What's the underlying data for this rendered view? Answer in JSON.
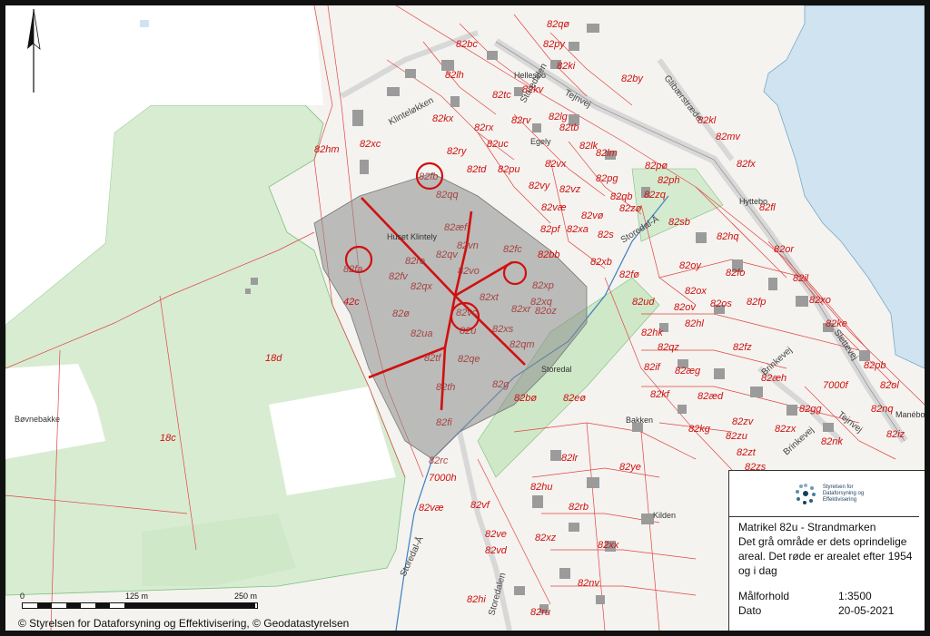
{
  "map": {
    "parcel_labels_primary": [
      {
        "id": "82qø"
      },
      {
        "id": "82py"
      },
      {
        "id": "82bc"
      },
      {
        "id": "82ki"
      },
      {
        "id": "82lh"
      },
      {
        "id": "82by"
      },
      {
        "id": "82tc"
      },
      {
        "id": "82kv"
      },
      {
        "id": "82kx"
      },
      {
        "id": "82lg"
      },
      {
        "id": "82rx"
      },
      {
        "id": "82rv"
      },
      {
        "id": "82tb"
      },
      {
        "id": "82kl"
      },
      {
        "id": "82mv"
      },
      {
        "id": "82hm"
      },
      {
        "id": "82xc"
      },
      {
        "id": "82uc"
      },
      {
        "id": "82ry"
      },
      {
        "id": "82lk"
      },
      {
        "id": "82lm"
      },
      {
        "id": "82td"
      },
      {
        "id": "82pu"
      },
      {
        "id": "82vx"
      },
      {
        "id": "82pø"
      },
      {
        "id": "82fx"
      },
      {
        "id": "82pg"
      },
      {
        "id": "82ph"
      },
      {
        "id": "82vy"
      },
      {
        "id": "82vz"
      },
      {
        "id": "82qb"
      },
      {
        "id": "82zq"
      },
      {
        "id": "82fl"
      },
      {
        "id": "82væ"
      },
      {
        "id": "82vø"
      },
      {
        "id": "82zø"
      },
      {
        "id": "82sb"
      },
      {
        "id": "82pf"
      },
      {
        "id": "82xa"
      },
      {
        "id": "82s"
      },
      {
        "id": "82hq"
      },
      {
        "id": "82or"
      },
      {
        "id": "82bb"
      },
      {
        "id": "82xb"
      },
      {
        "id": "82oy"
      },
      {
        "id": "82fø"
      },
      {
        "id": "82fo"
      },
      {
        "id": "82il"
      },
      {
        "id": "82ox"
      },
      {
        "id": "82xo"
      },
      {
        "id": "82ud"
      },
      {
        "id": "82ov"
      },
      {
        "id": "82os"
      },
      {
        "id": "82fp"
      },
      {
        "id": "82hl"
      },
      {
        "id": "82ke"
      },
      {
        "id": "82hk"
      },
      {
        "id": "82qz"
      },
      {
        "id": "82fz"
      },
      {
        "id": "82pb"
      },
      {
        "id": "82if"
      },
      {
        "id": "82æg"
      },
      {
        "id": "82æh"
      },
      {
        "id": "82ol"
      },
      {
        "id": "82kf"
      },
      {
        "id": "82æd"
      },
      {
        "id": "82gg"
      },
      {
        "id": "82nq"
      },
      {
        "id": "82kg"
      },
      {
        "id": "82zv"
      },
      {
        "id": "82zx"
      },
      {
        "id": "82zu"
      },
      {
        "id": "82nk"
      },
      {
        "id": "82iz"
      },
      {
        "id": "82zt"
      },
      {
        "id": "82zs"
      },
      {
        "id": "82bø"
      },
      {
        "id": "82eø"
      },
      {
        "id": "82lr"
      },
      {
        "id": "82ye"
      },
      {
        "id": "82hu"
      },
      {
        "id": "82vf"
      },
      {
        "id": "82rb"
      },
      {
        "id": "82ve"
      },
      {
        "id": "82xz"
      },
      {
        "id": "82vd"
      },
      {
        "id": "82xx"
      },
      {
        "id": "82nv"
      },
      {
        "id": "82ru"
      },
      {
        "id": "82hi"
      },
      {
        "id": "82væ"
      },
      {
        "id": "82rc"
      },
      {
        "id": "82fi"
      },
      {
        "id": "82th"
      },
      {
        "id": "82g"
      },
      {
        "id": "82tf"
      },
      {
        "id": "82qe"
      },
      {
        "id": "82qm"
      },
      {
        "id": "82oz"
      },
      {
        "id": "82xs"
      },
      {
        "id": "82xr"
      },
      {
        "id": "82xq"
      },
      {
        "id": "82xp"
      },
      {
        "id": "82xt"
      },
      {
        "id": "82ua"
      },
      {
        "id": "82u"
      },
      {
        "id": "82vc"
      },
      {
        "id": "82ø"
      },
      {
        "id": "82qx"
      },
      {
        "id": "82fv"
      },
      {
        "id": "82fa"
      },
      {
        "id": "82ro"
      },
      {
        "id": "82vn"
      },
      {
        "id": "82fc"
      },
      {
        "id": "82vo"
      },
      {
        "id": "82æf"
      },
      {
        "id": "82qq"
      },
      {
        "id": "82fb"
      },
      {
        "id": "82qv"
      },
      {
        "id": "42c"
      },
      {
        "id": "18d"
      },
      {
        "id": "18c"
      },
      {
        "id": "7000f"
      },
      {
        "id": "7000h"
      }
    ],
    "place_names": {
      "bovnebakke": "Bøvnebakke",
      "kilden": "Kilden",
      "hyttebo": "Hyttebo",
      "hus_klintely": "Huset Klintely",
      "storedal": "Storedal",
      "egely": "Egely",
      "hellesbo": "Hellesbo",
      "bakken": "Bakken",
      "maneborg": "Manéborg"
    },
    "streets": {
      "klintelokken": "Klinteløkken",
      "storedalen_n": "Storedalen",
      "tejnvej_n": "Tejnvej",
      "glibaerstraede": "Glibærstræde",
      "storedal_a_mid": "Storedal-Å",
      "storedal_a_s": "Storedal-Å",
      "storedalen_s": "Storedalen",
      "slettevej": "Slettevej",
      "brinkevej": "Brinkevej",
      "tejnvej_s": "Tejnvej",
      "brinkevej_s": "Brinkevej"
    }
  },
  "scale_bar": {
    "t0": "0",
    "t125": "125 m",
    "t250": "250 m"
  },
  "legend": {
    "logo_text_1": "Styrelsen for",
    "logo_text_2": "Dataforsyning og",
    "logo_text_3": "Effektivisering",
    "title": "Matrikel 82u - Strandmarken",
    "description": "Det grå område er dets oprindelige areal. Det røde er arealet efter 1954 og i dag",
    "scale_key": "Målforhold",
    "scale_value": "1:3500",
    "date_key": "Dato",
    "date_value": "20-05-2021"
  },
  "copyright": "© Styrelsen for Dataforsyning og Effektivisering, © Geodatastyrelsen",
  "north_arrow": "north-arrow-icon",
  "colors": {
    "parcel_line": "#e24444",
    "highlight": "#d01010",
    "forest": "#d6ecd0",
    "sea": "#cfe3f0",
    "gray_area": "#8a8a8a"
  }
}
